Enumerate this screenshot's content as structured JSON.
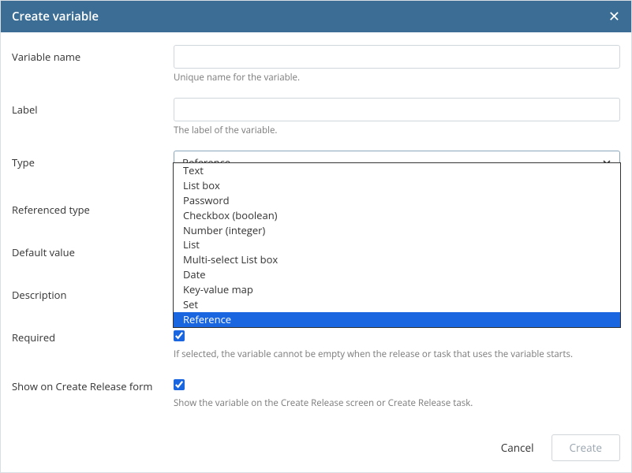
{
  "dialog": {
    "title": "Create variable"
  },
  "fields": {
    "variable_name": {
      "label": "Variable name",
      "value": "",
      "help": "Unique name for the variable."
    },
    "label_field": {
      "label": "Label",
      "value": "",
      "help": "The label of the variable."
    },
    "type": {
      "label": "Type",
      "selected": "Reference",
      "options": [
        "Text",
        "List box",
        "Password",
        "Checkbox (boolean)",
        "Number (integer)",
        "List",
        "Multi-select List box",
        "Date",
        "Key-value map",
        "Set",
        "Reference"
      ]
    },
    "referenced_type": {
      "label": "Referenced type"
    },
    "default_value": {
      "label": "Default value"
    },
    "description": {
      "label": "Description"
    },
    "required": {
      "label": "Required",
      "checked": true,
      "help": "If selected, the variable cannot be empty when the release or task that uses the variable starts."
    },
    "show_on_form": {
      "label": "Show on Create Release form",
      "checked": true,
      "help": "Show the variable on the Create Release screen or Create Release task."
    }
  },
  "footer": {
    "cancel": "Cancel",
    "create": "Create"
  }
}
